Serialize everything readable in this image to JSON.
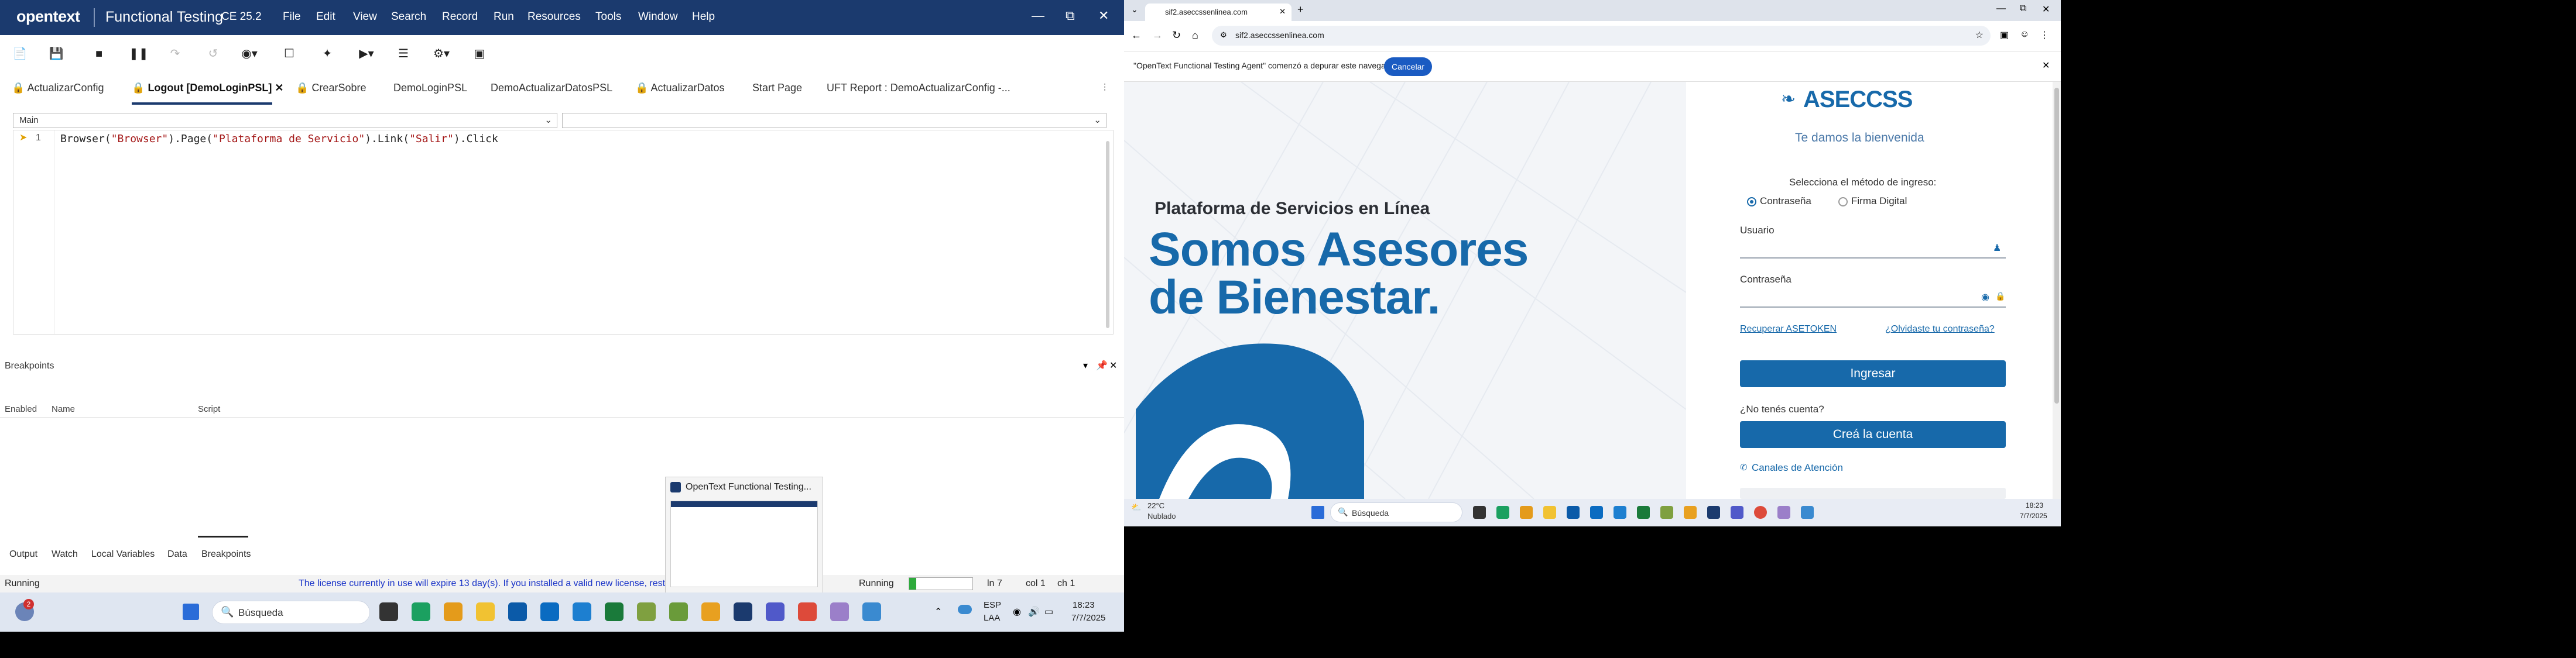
{
  "uft": {
    "logo": "opentext",
    "app_name": "Functional Testing",
    "version": "CE 25.2",
    "menu": [
      "File",
      "Edit",
      "View",
      "Search",
      "Record",
      "Run",
      "Resources",
      "Tools",
      "Window",
      "Help"
    ],
    "tabs": [
      {
        "label": "ActualizarConfig",
        "locked": true
      },
      {
        "label": "Logout [DemoLoginPSL]",
        "locked": true,
        "active": true
      },
      {
        "label": "CrearSobre",
        "locked": true
      },
      {
        "label": "DemoLoginPSL",
        "locked": false
      },
      {
        "label": "DemoActualizarDatosPSL",
        "locked": false
      },
      {
        "label": "ActualizarDatos",
        "locked": true
      },
      {
        "label": "Start Page",
        "locked": false
      },
      {
        "label": "UFT Report : DemoActualizarConfig -...",
        "locked": false
      }
    ],
    "action_combo": "Main",
    "line_number": "1",
    "code": {
      "p1": "Browser(",
      "s1": "\"Browser\"",
      "p2": ").Page(",
      "s2": "\"Plataforma de Servicio\"",
      "p3": ").Link(",
      "s3": "\"Salir\"",
      "p4": ").Click"
    },
    "breakpoints_title": "Breakpoints",
    "breakpoints_columns": [
      "Enabled",
      "Name",
      "Script"
    ],
    "bottom_tabs": [
      "Output",
      "Watch",
      "Local Variables",
      "Data",
      "Breakpoints"
    ],
    "active_bottom_tab": "Breakpoints",
    "status": {
      "left": "Running",
      "license": "The license currently in use will expire 13 day(s). If you installed a valid new license, restart the product.",
      "running": "Running",
      "ln": "ln 7",
      "col": "col 1",
      "ch": "ch 1"
    },
    "preview_title": "OpenText Functional Testing..."
  },
  "taskbar1": {
    "search_placeholder": "Búsqueda",
    "notifications": "2",
    "lang": "ESP",
    "lang2": "LAA",
    "time": "18:23",
    "date": "7/7/2025"
  },
  "chrome": {
    "tab_title": "sif2.aseccssenlinea.com",
    "url": "sif2.aseccssenlinea.com",
    "debug_banner": "\"OpenText Functional Testing Agent\" comenzó a depurar este navegador",
    "cancel_label": "Cancelar"
  },
  "aseccss": {
    "platform_heading": "Plataforma de Servicios en Línea",
    "hero_line1": "Somos Asesores",
    "hero_line2": "de Bienestar.",
    "logo_text": "ASECCSS",
    "welcome": "Te damos la bienvenida",
    "method_label": "Selecciona el método de ingreso:",
    "method_password": "Contraseña",
    "method_signature": "Firma Digital",
    "user_label": "Usuario",
    "password_label": "Contraseña",
    "recover_token": "Recuperar ASETOKEN",
    "forgot_password": "¿Olvidaste tu contraseña?",
    "login_button": "Ingresar",
    "no_account": "¿No tenés cuenta?",
    "create_account": "Creá la cuenta",
    "channels": "Canales de Atención"
  },
  "taskbar2": {
    "temp": "22°C",
    "weather": "Nublado",
    "search_placeholder": "Búsqueda",
    "time": "18:23",
    "date": "7/7/2025"
  }
}
